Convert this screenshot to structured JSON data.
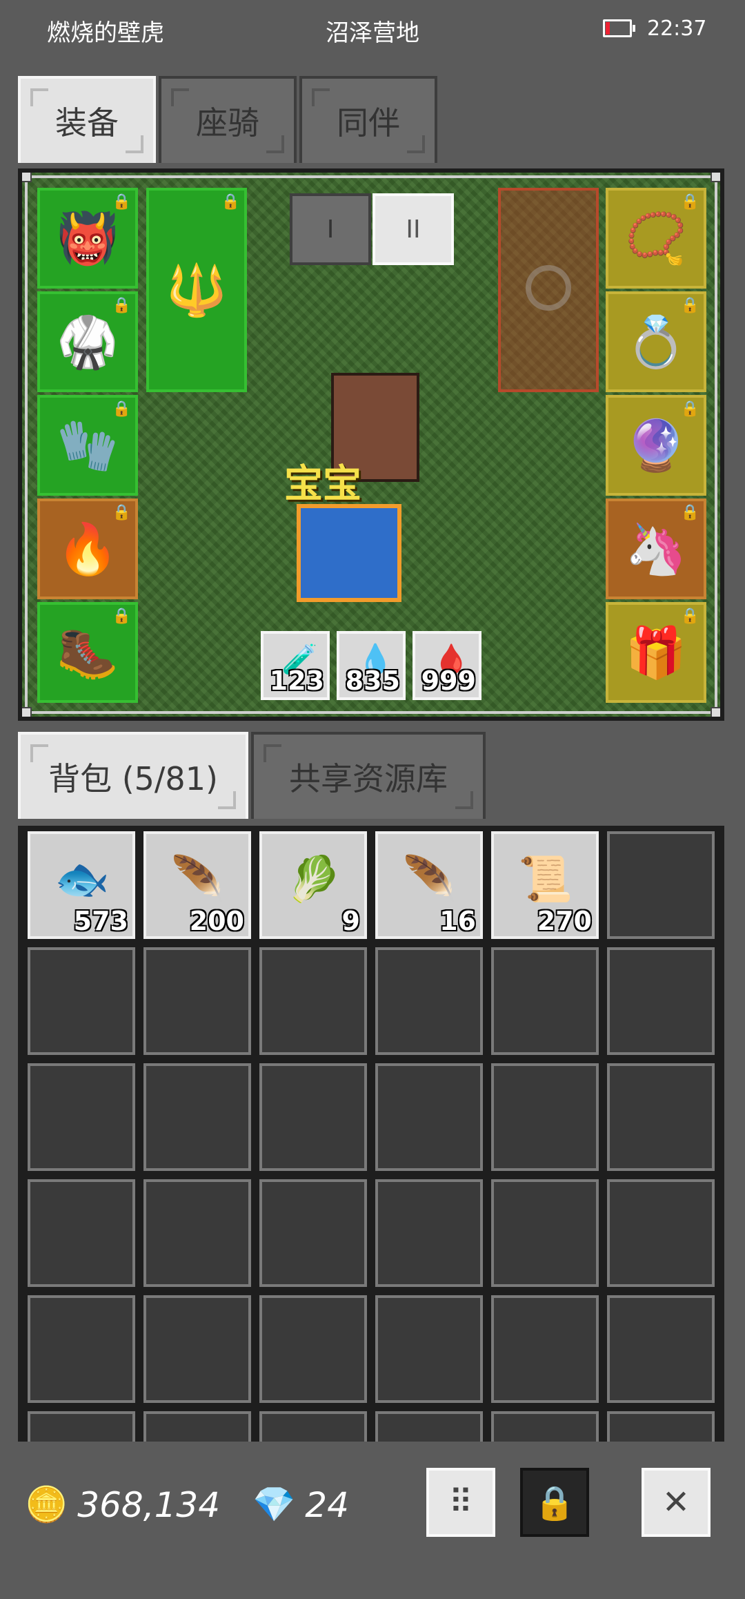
{
  "status_bar": {
    "left_text": "燃烧的壁虎",
    "center_text": "沼泽营地",
    "time": "22:37",
    "battery_color": "#e23333"
  },
  "top_tabs": [
    {
      "label": "装备",
      "active": true
    },
    {
      "label": "座骑",
      "active": false
    },
    {
      "label": "同伴",
      "active": false
    }
  ],
  "equipment": {
    "page_tabs": [
      {
        "label": "I",
        "active": false
      },
      {
        "label": "II",
        "active": true
      }
    ],
    "hero_name": "宝宝",
    "left_slots": [
      {
        "icon": "horned-helmet-icon",
        "rarity": "green"
      },
      {
        "icon": "green-armor-icon",
        "rarity": "green"
      },
      {
        "icon": "dark-gloves-icon",
        "rarity": "green"
      },
      {
        "icon": "fire-pants-icon",
        "rarity": "orange"
      },
      {
        "icon": "dark-boots-icon",
        "rarity": "green"
      }
    ],
    "weapon_slot": {
      "icon": "spear-icon",
      "rarity": "green"
    },
    "right_slots": [
      {
        "icon": "gold-necklace-icon",
        "rarity": "gold"
      },
      {
        "icon": "gold-ring-icon",
        "rarity": "gold"
      },
      {
        "icon": "purple-gem-ring-icon",
        "rarity": "gold"
      },
      {
        "icon": "pet-portrait-icon",
        "rarity": "orange"
      },
      {
        "icon": "companion-portrait-icon",
        "rarity": "gold"
      }
    ],
    "potions": [
      {
        "icon": "white-potion-icon",
        "count": "123"
      },
      {
        "icon": "blue-potion-icon",
        "count": "835"
      },
      {
        "icon": "red-potion-icon",
        "count": "999"
      }
    ]
  },
  "bag_tabs": [
    {
      "label": "背包 (5/81)",
      "active": true
    },
    {
      "label": "共享资源库",
      "active": false
    }
  ],
  "inventory": {
    "items": [
      {
        "icon": "fish-icon",
        "count": "573"
      },
      {
        "icon": "red-feather-icon",
        "count": "200"
      },
      {
        "icon": "green-cabbage-icon",
        "count": "9"
      },
      {
        "icon": "pink-feather-icon",
        "count": "16"
      },
      {
        "icon": "scroll-icon",
        "count": "270"
      }
    ]
  },
  "footer": {
    "gold": "368,134",
    "gems": "24",
    "gold_icon": "gold-nuggets-icon",
    "gem_icon": "green-gem-icon"
  },
  "colors": {
    "equip_green": "#25a323",
    "equip_orange": "#a86322",
    "equip_gold": "#a89a22",
    "hero_name": "#f6e14a"
  }
}
